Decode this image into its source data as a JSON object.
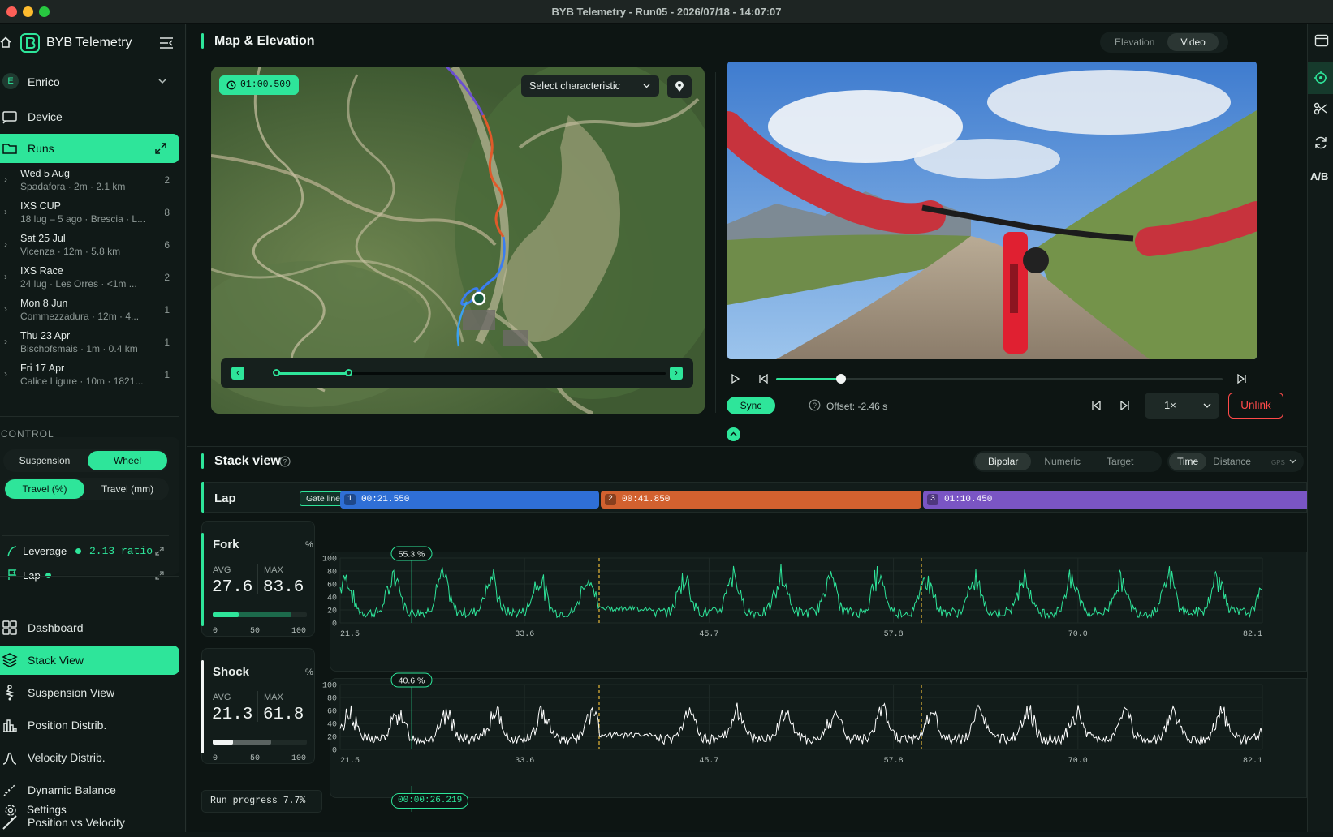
{
  "window": {
    "title": "BYB Telemetry - Run05 - 2026/07/18 - 14:07:07"
  },
  "sidebar": {
    "app_name": "BYB Telemetry",
    "user": {
      "initial": "E",
      "name": "Enrico"
    },
    "device_label": "Device",
    "runs_label": "Runs",
    "runs": [
      {
        "title": "Wed 5 Aug",
        "sub": "Spadafora  ·  2m  ·  2.1 km",
        "count": "2"
      },
      {
        "title": "IXS CUP",
        "sub": "18 lug – 5 ago  ·  Brescia  ·  L...",
        "count": "8"
      },
      {
        "title": "Sat 25 Jul",
        "sub": "Vicenza  ·  12m  ·  5.8 km",
        "count": "6"
      },
      {
        "title": "IXS Race",
        "sub": "24 lug  ·  Les Orres  ·  <1m  ...",
        "count": "2"
      },
      {
        "title": "Mon 8 Jun",
        "sub": "Commezzadura  ·  12m  ·  4...",
        "count": "1"
      },
      {
        "title": "Thu 23 Apr",
        "sub": "Bischofsmais  ·  1m  ·  0.4 km",
        "count": "1"
      },
      {
        "title": "Fri 17 Apr",
        "sub": "Calice Ligure  ·  10m  ·  1821...",
        "count": "1"
      }
    ],
    "control": {
      "heading": "CONTROL",
      "mode": [
        "Suspension",
        "Wheel"
      ],
      "units": [
        "Travel (%)",
        "Travel (mm)"
      ],
      "leverage_label": "Leverage",
      "leverage_value": "2.13 ratio",
      "lap_label": "Lap"
    },
    "nav": [
      "Dashboard",
      "Stack View",
      "Suspension View",
      "Position Distrib.",
      "Velocity Distrib.",
      "Dynamic Balance",
      "Position vs Velocity"
    ],
    "settings_label": "Settings"
  },
  "map_panel": {
    "title": "Map & Elevation",
    "tabs": [
      "Elevation",
      "Video"
    ],
    "time_badge": "01:00.509",
    "select_placeholder": "Select characteristic"
  },
  "video": {
    "sync_label": "Sync",
    "offset_label": "Offset: -2.46 s",
    "speed": "1×",
    "unlink_label": "Unlink",
    "progress": 0.145
  },
  "stack": {
    "title": "Stack view",
    "view_tabs": [
      "Bipolar",
      "Numeric",
      "Target"
    ],
    "axis_tabs": [
      "Time",
      "Distance"
    ],
    "gps_label": "GPS",
    "lap": {
      "label": "Lap",
      "gate_label": "Gate lines",
      "segments": [
        {
          "n": "1",
          "time": "00:21.550",
          "color": "#2f6fd6"
        },
        {
          "n": "2",
          "time": "00:41.850",
          "color": "#d2612f"
        },
        {
          "n": "3",
          "time": "01:10.450",
          "color": "#7a55c4"
        }
      ]
    },
    "fork": {
      "name": "Fork",
      "unit": "%",
      "avg_label": "AVG",
      "avg": "27.6",
      "max_label": "MAX",
      "max": "83.6",
      "cursor_value": "55.3 %",
      "bar_ticks": [
        "0",
        "50",
        "100"
      ],
      "avg_frac": 0.276,
      "max_frac": 0.836
    },
    "shock": {
      "name": "Shock",
      "unit": "%",
      "avg_label": "AVG",
      "avg": "21.3",
      "max_label": "MAX",
      "max": "61.8",
      "cursor_value": "40.6 %",
      "bar_ticks": [
        "0",
        "50",
        "100"
      ],
      "avg_frac": 0.213,
      "max_frac": 0.618
    },
    "yticks": [
      "100",
      "80",
      "60",
      "40",
      "20",
      "0"
    ],
    "xticks": [
      "21.5",
      "33.6",
      "45.7",
      "57.8",
      "70.0",
      "82.1"
    ],
    "run_progress": "Run progress 7.7%",
    "cursor_time": "00:00:26.219"
  },
  "colors": {
    "accent": "#2ee59a",
    "fork_line": "#2ee59a",
    "shock_line": "#ffffff",
    "gate": "#e8b83a",
    "unlink": "#ff4a4a"
  }
}
